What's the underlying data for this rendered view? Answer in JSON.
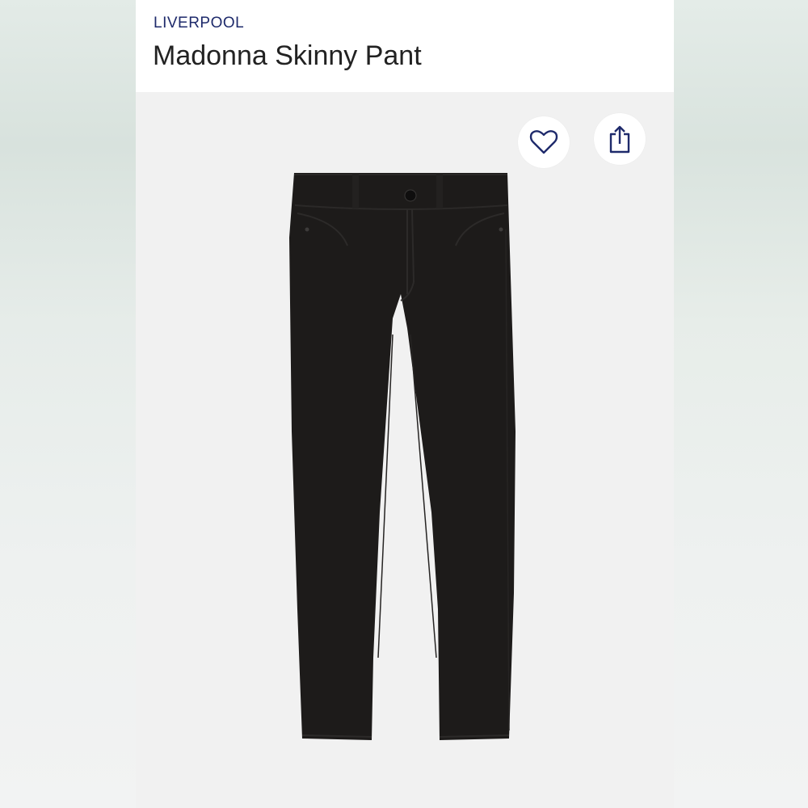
{
  "product": {
    "brand": "LIVERPOOL",
    "name": "Madonna Skinny Pant"
  },
  "image": {
    "description_icon": "product-photo",
    "garment_color": "#1c1a19"
  },
  "actions": {
    "favorite_icon": "heart-icon",
    "share_icon": "share-icon"
  },
  "colors": {
    "brand": "#1e2a6b",
    "title": "#222222",
    "photo_bg": "#f1f1f1"
  }
}
